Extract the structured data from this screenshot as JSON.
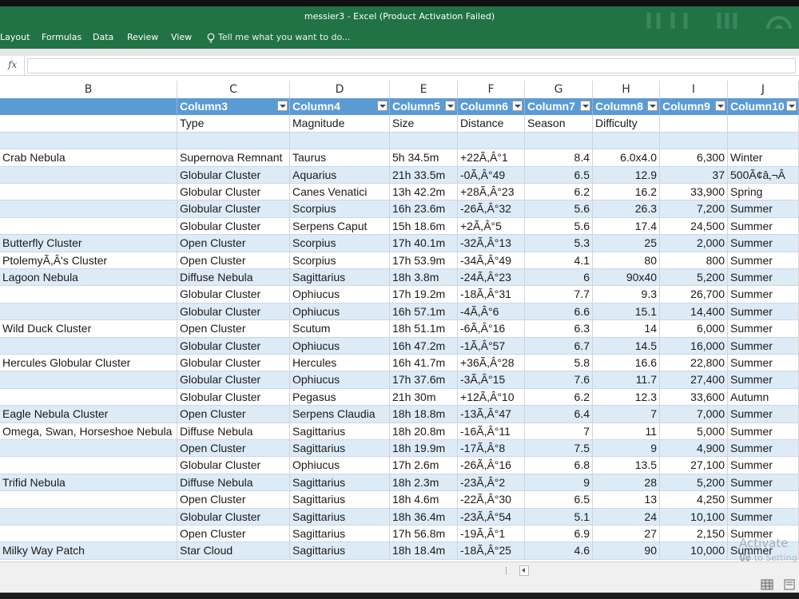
{
  "window": {
    "title": "messier3 - Excel (Product Activation Failed)"
  },
  "ribbon": {
    "tabs": [
      "Layout",
      "Formulas",
      "Data",
      "Review",
      "View"
    ],
    "tell_me": "Tell me what you want to do..."
  },
  "formula_bar": {
    "fx_label": "fx",
    "value": ""
  },
  "column_letters": [
    "B",
    "C",
    "D",
    "E",
    "F",
    "G",
    "H",
    "I",
    "J"
  ],
  "table": {
    "header": [
      "",
      "Column3",
      "Column4",
      "Column5",
      "Column6",
      "Column7",
      "Column8",
      "Column9",
      "Column10"
    ],
    "rows": [
      [
        "",
        "Type",
        "Magnitude",
        "Size",
        "Distance",
        "Season",
        "Difficulty",
        "",
        ""
      ],
      [
        "",
        "",
        "",
        "",
        "",
        "",
        "",
        "",
        ""
      ],
      [
        "Crab Nebula",
        "Supernova Remnant",
        "Taurus",
        "5h 34.5m",
        "+22Ã,Â°1",
        "8.4",
        "6.0x4.0",
        "6,300",
        "Winter"
      ],
      [
        "",
        "Globular Cluster",
        "Aquarius",
        "21h 33.5m",
        "-0Ã,Â°49",
        "6.5",
        "12.9",
        "37",
        "500Ã¢â‚¬Â"
      ],
      [
        "",
        "Globular Cluster",
        "Canes Venatici",
        "13h 42.2m",
        "+28Ã,Â°23",
        "6.2",
        "16.2",
        "33,900",
        "Spring"
      ],
      [
        "",
        "Globular Cluster",
        "Scorpius",
        "16h 23.6m",
        "-26Ã,Â°32",
        "5.6",
        "26.3",
        "7,200",
        "Summer"
      ],
      [
        "",
        "Globular Cluster",
        "Serpens Caput",
        "15h 18.6m",
        "+2Ã,Â°5",
        "5.6",
        "17.4",
        "24,500",
        "Summer"
      ],
      [
        "Butterfly Cluster",
        "Open Cluster",
        "Scorpius",
        "17h 40.1m",
        "-32Ã,Â°13",
        "5.3",
        "25",
        "2,000",
        "Summer"
      ],
      [
        "PtolemyÃ,Â's Cluster",
        "Open Cluster",
        "Scorpius",
        "17h 53.9m",
        "-34Ã,Â°49",
        "4.1",
        "80",
        "800",
        "Summer"
      ],
      [
        "Lagoon Nebula",
        "Diffuse Nebula",
        "Sagittarius",
        "18h 3.8m",
        "-24Ã,Â°23",
        "6",
        "90x40",
        "5,200",
        "Summer"
      ],
      [
        "",
        "Globular Cluster",
        "Ophiucus",
        "17h 19.2m",
        "-18Ã,Â°31",
        "7.7",
        "9.3",
        "26,700",
        "Summer"
      ],
      [
        "",
        "Globular Cluster",
        "Ophiucus",
        "16h 57.1m",
        "-4Ã,Â°6",
        "6.6",
        "15.1",
        "14,400",
        "Summer"
      ],
      [
        "Wild Duck Cluster",
        "Open Cluster",
        "Scutum",
        "18h 51.1m",
        "-6Ã,Â°16",
        "6.3",
        "14",
        "6,000",
        "Summer"
      ],
      [
        "",
        "Globular Cluster",
        "Ophiucus",
        "16h 47.2m",
        "-1Ã,Â°57",
        "6.7",
        "14.5",
        "16,000",
        "Summer"
      ],
      [
        "Hercules Globular Cluster",
        "Globular Cluster",
        "Hercules",
        "16h 41.7m",
        "+36Ã,Â°28",
        "5.8",
        "16.6",
        "22,800",
        "Summer"
      ],
      [
        "",
        "Globular Cluster",
        "Ophiucus",
        "17h 37.6m",
        "-3Ã,Â°15",
        "7.6",
        "11.7",
        "27,400",
        "Summer"
      ],
      [
        "",
        "Globular Cluster",
        "Pegasus",
        "21h 30m",
        "+12Ã,Â°10",
        "6.2",
        "12.3",
        "33,600",
        "Autumn"
      ],
      [
        "Eagle Nebula Cluster",
        "Open Cluster",
        "Serpens Claudia",
        "18h 18.8m",
        "-13Ã,Â°47",
        "6.4",
        "7",
        "7,000",
        "Summer"
      ],
      [
        "Omega, Swan, Horseshoe Nebula",
        "Diffuse Nebula",
        "Sagittarius",
        "18h 20.8m",
        "-16Ã,Â°11",
        "7",
        "11",
        "5,000",
        "Summer"
      ],
      [
        "",
        "Open Cluster",
        "Sagittarius",
        "18h 19.9m",
        "-17Ã,Â°8",
        "7.5",
        "9",
        "4,900",
        "Summer"
      ],
      [
        "",
        "Globular Cluster",
        "Ophiucus",
        "17h 2.6m",
        "-26Ã,Â°16",
        "6.8",
        "13.5",
        "27,100",
        "Summer"
      ],
      [
        "Trifid Nebula",
        "Diffuse Nebula",
        "Sagittarius",
        "18h 2.3m",
        "-23Ã,Â°2",
        "9",
        "28",
        "5,200",
        "Summer"
      ],
      [
        "",
        "Open Cluster",
        "Sagittarius",
        "18h 4.6m",
        "-22Ã,Â°30",
        "6.5",
        "13",
        "4,250",
        "Summer"
      ],
      [
        "",
        "Globular Cluster",
        "Sagittarius",
        "18h 36.4m",
        "-23Ã,Â°54",
        "5.1",
        "24",
        "10,100",
        "Summer"
      ],
      [
        "",
        "Open Cluster",
        "Sagittarius",
        "17h 56.8m",
        "-19Ã,Â°1",
        "6.9",
        "27",
        "2,150",
        "Summer"
      ],
      [
        "Milky Way Patch",
        "Star Cloud",
        "Sagittarius",
        "18h 18.4m",
        "-18Ã,Â°25",
        "4.6",
        "90",
        "10,000",
        "Summer"
      ]
    ]
  },
  "watermark": {
    "line1": "Activate W",
    "line2": "Go to Setting"
  },
  "colors": {
    "excel_green": "#217346",
    "header_blue": "#5b9bd5",
    "band_blue": "#ddebf7"
  }
}
